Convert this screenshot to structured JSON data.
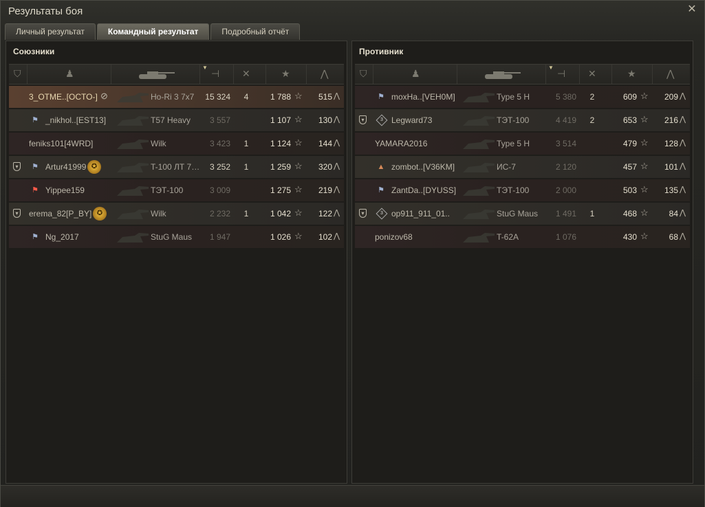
{
  "window": {
    "title": "Результаты боя",
    "close_icon": "close-icon"
  },
  "tabs": [
    {
      "label": "Личный результат",
      "active": false
    },
    {
      "label": "Командный результат",
      "active": true
    },
    {
      "label": "Подробный отчёт",
      "active": false
    }
  ],
  "allies": {
    "title": "Союзники",
    "rows": [
      {
        "clan": false,
        "badge": "none",
        "name": "3_OTME..[OCTO-]",
        "mark": "eye",
        "medal": false,
        "tank": "Ho-Ri 3 7x7",
        "damage": "15 324",
        "damage_hi": true,
        "frags": "4",
        "xp": "1 788",
        "points": "515",
        "me": true
      },
      {
        "clan": false,
        "badge": "flag",
        "name": "_nikhol..[EST13]",
        "mark": "",
        "medal": false,
        "tank": "T57 Heavy",
        "damage": "3 557",
        "damage_hi": false,
        "frags": "",
        "xp": "1 107",
        "points": "130",
        "me": false
      },
      {
        "clan": false,
        "badge": "none",
        "name": "feniks101[4WRD]",
        "mark": "",
        "medal": false,
        "tank": "Wilk",
        "damage": "3 423",
        "damage_hi": false,
        "frags": "1",
        "xp": "1 124",
        "points": "144",
        "me": false
      },
      {
        "clan": true,
        "badge": "flag",
        "name": "Artur41999",
        "mark": "",
        "medal": true,
        "tank": "T-100 ЛТ 7…",
        "damage": "3 252",
        "damage_hi": true,
        "frags": "1",
        "xp": "1 259",
        "points": "320",
        "me": false
      },
      {
        "clan": false,
        "badge": "red",
        "name": "Yippee159",
        "mark": "",
        "medal": false,
        "tank": "ТЭТ-100",
        "damage": "3 009",
        "damage_hi": false,
        "frags": "",
        "xp": "1 275",
        "points": "219",
        "me": false
      },
      {
        "clan": true,
        "badge": "none",
        "name": "erema_82[P_BY]",
        "mark": "",
        "medal": true,
        "tank": "Wilk",
        "damage": "2 232",
        "damage_hi": false,
        "frags": "1",
        "xp": "1 042",
        "points": "122",
        "me": false
      },
      {
        "clan": false,
        "badge": "flag",
        "name": "Ng_2017",
        "mark": "",
        "medal": false,
        "tank": "StuG Maus",
        "damage": "1 947",
        "damage_hi": false,
        "frags": "",
        "xp": "1 026",
        "points": "102",
        "me": false
      }
    ]
  },
  "enemies": {
    "title": "Противник",
    "rows": [
      {
        "clan": false,
        "badge": "flag",
        "name": "moxHa..[VEH0M]",
        "mark": "",
        "medal": false,
        "tank": "Type 5 H",
        "damage": "5 380",
        "damage_hi": false,
        "frags": "2",
        "xp": "609",
        "points": "209",
        "me": false
      },
      {
        "clan": true,
        "badge": "rank",
        "rank_num": "3",
        "name": "Legward73",
        "mark": "",
        "medal": false,
        "tank": "ТЭТ-100",
        "damage": "4 419",
        "damage_hi": false,
        "frags": "2",
        "xp": "653",
        "points": "216",
        "me": false
      },
      {
        "clan": false,
        "badge": "none",
        "name": "YAMARA2016",
        "mark": "",
        "medal": false,
        "tank": "Type 5 H",
        "damage": "3 514",
        "damage_hi": false,
        "frags": "",
        "xp": "479",
        "points": "128",
        "me": false
      },
      {
        "clan": false,
        "badge": "bronze",
        "name": "zombot..[V36KM]",
        "mark": "",
        "medal": false,
        "tank": "ИС-7",
        "damage": "2 120",
        "damage_hi": false,
        "frags": "",
        "xp": "457",
        "points": "101",
        "me": false
      },
      {
        "clan": false,
        "badge": "flag",
        "name": "ZantDa..[DYUSS]",
        "mark": "",
        "medal": false,
        "tank": "ТЭТ-100",
        "damage": "2 000",
        "damage_hi": false,
        "frags": "",
        "xp": "503",
        "points": "135",
        "me": false
      },
      {
        "clan": true,
        "badge": "rank",
        "rank_num": "3",
        "name": "op911_911_01..",
        "mark": "",
        "medal": false,
        "tank": "StuG Maus",
        "damage": "1 491",
        "damage_hi": false,
        "frags": "1",
        "xp": "468",
        "points": "84",
        "me": false
      },
      {
        "clan": false,
        "badge": "none",
        "name": "ponizov68",
        "mark": "",
        "medal": false,
        "tank": "T-62A",
        "damage": "1 076",
        "damage_hi": false,
        "frags": "",
        "xp": "430",
        "points": "68",
        "me": false
      }
    ]
  },
  "header_icons": [
    "clan-column-icon",
    "player-column-icon",
    "tank-column-icon",
    "damage-column-icon",
    "frags-column-icon",
    "xp-column-icon",
    "points-column-icon"
  ],
  "colors": {
    "accent_sort": "#cfc597",
    "self_row": "#5a4030"
  }
}
